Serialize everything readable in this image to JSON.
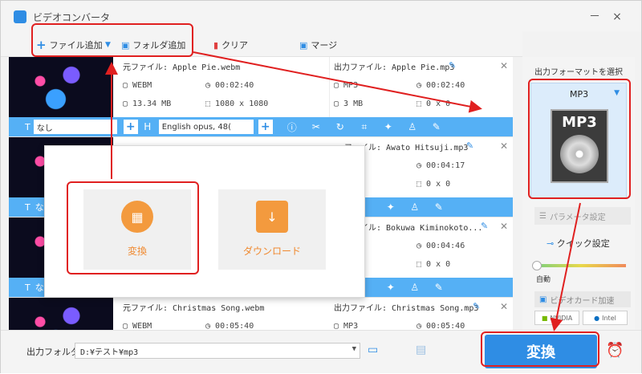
{
  "window": {
    "title": "ビデオコンバータ",
    "minimize": "－",
    "maximize": "□",
    "close": "×"
  },
  "toolbar": {
    "add_file": "ファイル追加",
    "add_folder": "フォルダ追加",
    "clear": "クリア",
    "merge": "マージ"
  },
  "files": [
    {
      "thumb_caption": "",
      "source_label": "元ファイル: Apple Pie.webm",
      "src_format": "WEBM",
      "src_duration": "00:02:40",
      "src_size": "13.34 MB",
      "src_resolution": "1080 x 1080",
      "output_label": "出力ファイル: Apple Pie.mp3",
      "out_format": "MP3",
      "out_duration": "00:02:40",
      "out_size": "3 MB",
      "out_resolution": "0 x 0",
      "subtitle": "なし",
      "audio": "English opus, 48("
    },
    {
      "output_label": "ファイル: Awato Hitsuji.mp3",
      "out_duration": "00:04:17",
      "out_resolution": "0 x 0",
      "subtitle": "な"
    },
    {
      "output_label": "ファイル: Bokuwa Kiminokoto...",
      "out_duration": "00:04:46",
      "out_resolution": "0 x 0",
      "subtitle": "な"
    },
    {
      "source_label": "元ファイル: Christmas Song.webm",
      "src_format": "WEBM",
      "src_duration": "00:05:40",
      "output_label": "出力ファイル: Christmas Song.mp3",
      "out_format": "MP3",
      "out_duration": "00:05:40"
    }
  ],
  "right_panel": {
    "title": "出力フォーマットを選択",
    "format": "MP3",
    "format_icon_text": "MP3",
    "param_settings": "パラメータ設定",
    "quick_settings": "クイック設定",
    "auto": "自動",
    "hw_accel": "ビデオカード加速",
    "chip_nvidia": "NVIDIA",
    "chip_intel": "Intel"
  },
  "bottom": {
    "output_folder_label": "出力フォルダ：",
    "output_folder_value": "D:¥テスト¥mp3",
    "convert": "変換"
  },
  "overlay": {
    "convert_label": "変換",
    "download_label": "ダウンロード"
  },
  "colors": {
    "accent": "#2f8de4",
    "bar_blue": "#55b0f5",
    "orange": "#f39a3e",
    "annotation_red": "#e02020"
  }
}
